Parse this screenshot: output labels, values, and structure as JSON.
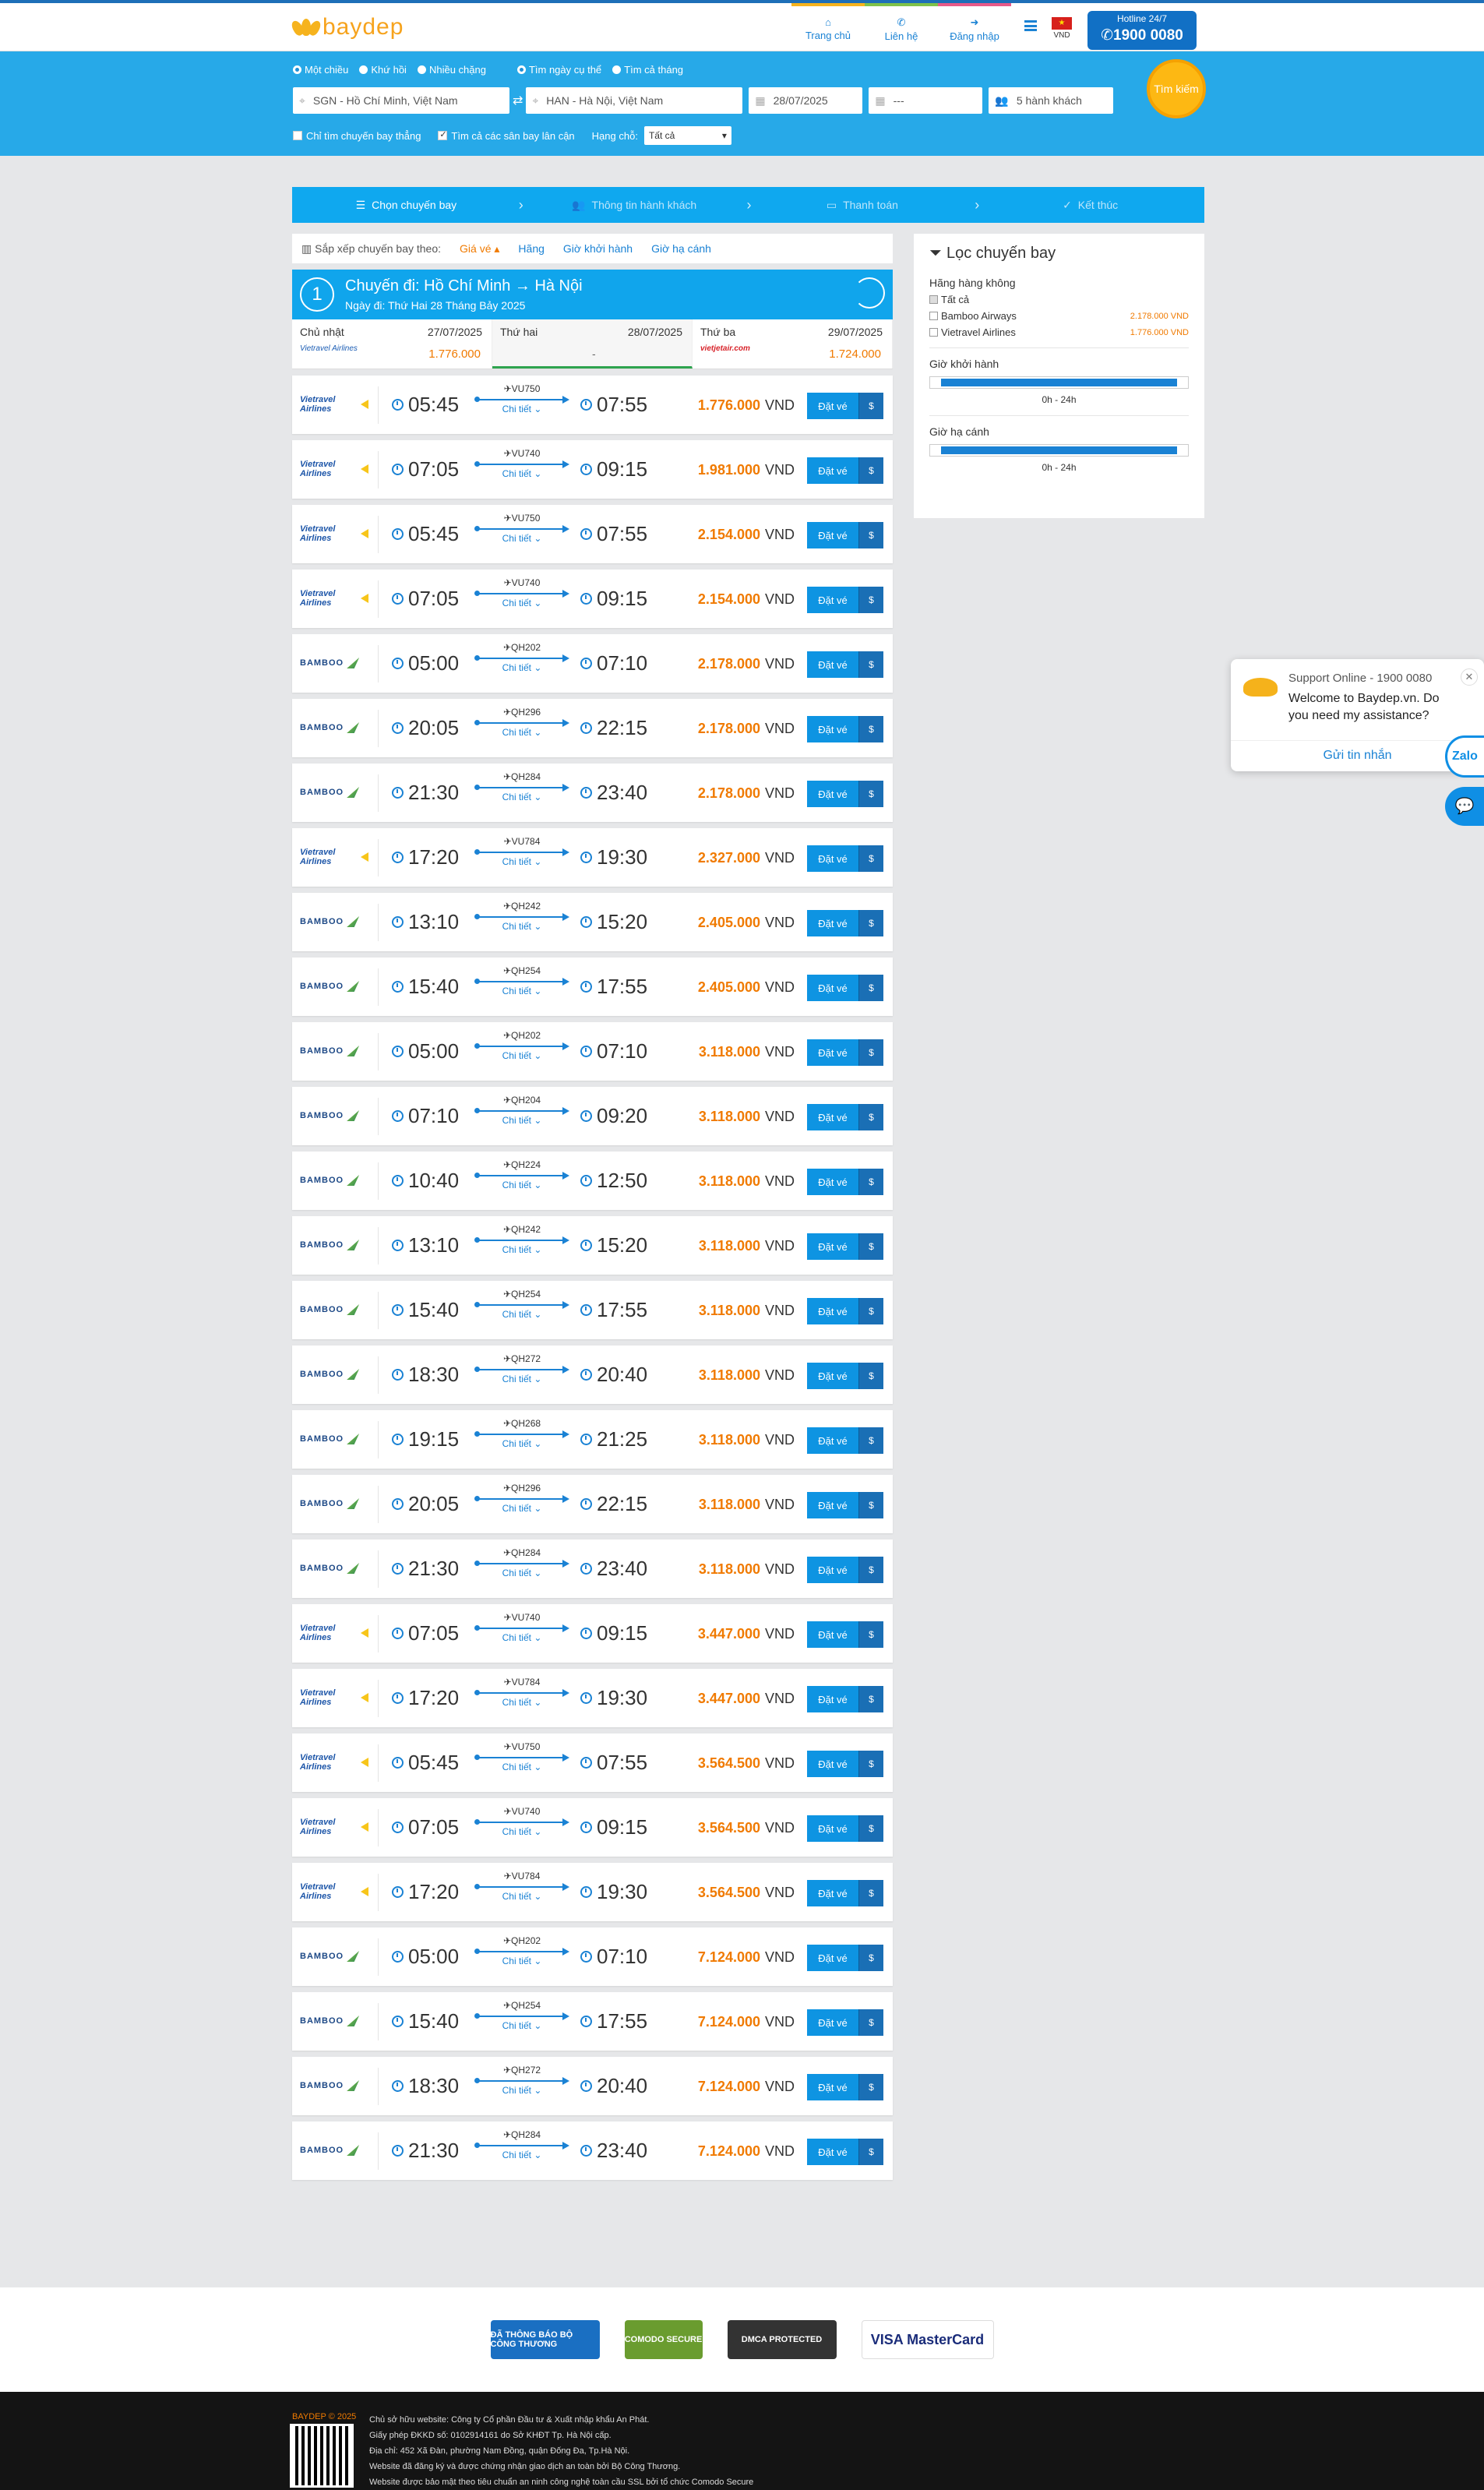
{
  "header": {
    "logo": "baydep",
    "nav": [
      {
        "label": "Trang chủ",
        "icon": "home-icon",
        "color": "#f6b31d"
      },
      {
        "label": "Liên hệ",
        "icon": "phone-icon",
        "color": "#7fc24a"
      },
      {
        "label": "Đăng nhập",
        "icon": "login-icon",
        "color": "#e85a8a"
      }
    ],
    "currency": "VND",
    "hotline_label": "Hotline 24/7",
    "hotline_number": "1900 0080"
  },
  "search": {
    "trip_types": [
      "Một chiều",
      "Khứ hồi",
      "Nhiều chặng"
    ],
    "date_modes": [
      "Tìm ngày cụ thể",
      "Tìm cả tháng"
    ],
    "from": "SGN - Hồ Chí Minh, Việt Nam",
    "to": "HAN - Hà Nội, Việt Nam",
    "depart_date": "28/07/2025",
    "return_date": "---",
    "passengers": "5 hành khách",
    "search_button": "Tìm kiếm",
    "direct_only": "Chỉ tìm chuyến bay thẳng",
    "nearby": "Tìm cả các sân bay lân cận",
    "class_label": "Hạng chỗ:",
    "class_value": "Tất cả"
  },
  "steps": [
    "Chọn chuyến bay",
    "Thông tin hành khách",
    "Thanh toán",
    "Kết thúc"
  ],
  "sort": {
    "label": "Sắp xếp chuyến bay theo:",
    "options": [
      "Giá vé",
      "Hãng",
      "Giờ khởi hành",
      "Giờ hạ cánh"
    ]
  },
  "route": {
    "num": "1",
    "title": "Chuyến đi: Hồ Chí Minh → Hà Nội",
    "date": "Ngày đi: Thứ Hai 28 Tháng Bảy 2025"
  },
  "dates": [
    {
      "day": "Chủ nhật",
      "date": "27/07/2025",
      "airline": "Vietravel Airlines",
      "price": "1.776.000"
    },
    {
      "day": "Thứ hai",
      "date": "28/07/2025",
      "airline": "",
      "price": "-"
    },
    {
      "day": "Thứ ba",
      "date": "29/07/2025",
      "airline": "vietjetair.com",
      "price": "1.724.000"
    }
  ],
  "flights": [
    {
      "airline": "vj",
      "dep": "05:45",
      "no": "VU750",
      "arr": "07:55",
      "price": "1.776.000"
    },
    {
      "airline": "vj",
      "dep": "07:05",
      "no": "VU740",
      "arr": "09:15",
      "price": "1.981.000"
    },
    {
      "airline": "vj",
      "dep": "05:45",
      "no": "VU750",
      "arr": "07:55",
      "price": "2.154.000"
    },
    {
      "airline": "vj",
      "dep": "07:05",
      "no": "VU740",
      "arr": "09:15",
      "price": "2.154.000"
    },
    {
      "airline": "bb",
      "dep": "05:00",
      "no": "QH202",
      "arr": "07:10",
      "price": "2.178.000"
    },
    {
      "airline": "bb",
      "dep": "20:05",
      "no": "QH296",
      "arr": "22:15",
      "price": "2.178.000"
    },
    {
      "airline": "bb",
      "dep": "21:30",
      "no": "QH284",
      "arr": "23:40",
      "price": "2.178.000"
    },
    {
      "airline": "vj",
      "dep": "17:20",
      "no": "VU784",
      "arr": "19:30",
      "price": "2.327.000"
    },
    {
      "airline": "bb",
      "dep": "13:10",
      "no": "QH242",
      "arr": "15:20",
      "price": "2.405.000"
    },
    {
      "airline": "bb",
      "dep": "15:40",
      "no": "QH254",
      "arr": "17:55",
      "price": "2.405.000"
    },
    {
      "airline": "bb",
      "dep": "05:00",
      "no": "QH202",
      "arr": "07:10",
      "price": "3.118.000"
    },
    {
      "airline": "bb",
      "dep": "07:10",
      "no": "QH204",
      "arr": "09:20",
      "price": "3.118.000"
    },
    {
      "airline": "bb",
      "dep": "10:40",
      "no": "QH224",
      "arr": "12:50",
      "price": "3.118.000"
    },
    {
      "airline": "bb",
      "dep": "13:10",
      "no": "QH242",
      "arr": "15:20",
      "price": "3.118.000"
    },
    {
      "airline": "bb",
      "dep": "15:40",
      "no": "QH254",
      "arr": "17:55",
      "price": "3.118.000"
    },
    {
      "airline": "bb",
      "dep": "18:30",
      "no": "QH272",
      "arr": "20:40",
      "price": "3.118.000"
    },
    {
      "airline": "bb",
      "dep": "19:15",
      "no": "QH268",
      "arr": "21:25",
      "price": "3.118.000"
    },
    {
      "airline": "bb",
      "dep": "20:05",
      "no": "QH296",
      "arr": "22:15",
      "price": "3.118.000"
    },
    {
      "airline": "bb",
      "dep": "21:30",
      "no": "QH284",
      "arr": "23:40",
      "price": "3.118.000"
    },
    {
      "airline": "vj",
      "dep": "07:05",
      "no": "VU740",
      "arr": "09:15",
      "price": "3.447.000"
    },
    {
      "airline": "vj",
      "dep": "17:20",
      "no": "VU784",
      "arr": "19:30",
      "price": "3.447.000"
    },
    {
      "airline": "vj",
      "dep": "05:45",
      "no": "VU750",
      "arr": "07:55",
      "price": "3.564.500"
    },
    {
      "airline": "vj",
      "dep": "07:05",
      "no": "VU740",
      "arr": "09:15",
      "price": "3.564.500"
    },
    {
      "airline": "vj",
      "dep": "17:20",
      "no": "VU784",
      "arr": "19:30",
      "price": "3.564.500"
    },
    {
      "airline": "bb",
      "dep": "05:00",
      "no": "QH202",
      "arr": "07:10",
      "price": "7.124.000"
    },
    {
      "airline": "bb",
      "dep": "15:40",
      "no": "QH254",
      "arr": "17:55",
      "price": "7.124.000"
    },
    {
      "airline": "bb",
      "dep": "18:30",
      "no": "QH272",
      "arr": "20:40",
      "price": "7.124.000"
    },
    {
      "airline": "bb",
      "dep": "21:30",
      "no": "QH284",
      "arr": "23:40",
      "price": "7.124.000"
    }
  ],
  "flight_labels": {
    "detail": "Chi tiết",
    "currency": "VND",
    "book": "Đặt vé",
    "dollar": "$",
    "vj_name": "Vietravel Airlines",
    "bb_name": "BAMBOO"
  },
  "filter": {
    "title": "Lọc chuyến bay",
    "airline_head": "Hãng hàng không",
    "all": "Tất cả",
    "airlines": [
      {
        "name": "Bamboo Airways",
        "price": "2.178.000 VND"
      },
      {
        "name": "Vietravel Airlines",
        "price": "1.776.000 VND"
      }
    ],
    "dep_head": "Giờ khởi hành",
    "dep_range": "0h - 24h",
    "arr_head": "Giờ hạ cánh",
    "arr_range": "0h - 24h"
  },
  "support": {
    "title": "Support Online - 1900 0080",
    "message": "Welcome to Baydep.vn. Do you need my assistance?",
    "button": "Gửi tin nhắn",
    "zalo": "Zalo"
  },
  "badges": [
    "ĐÃ THÔNG BÁO BỘ CÔNG THƯƠNG",
    "COMODO SECURE",
    "DMCA PROTECTED",
    "VISA MasterCard"
  ],
  "footer": {
    "copyright": "BAYDEP © 2025",
    "lines": [
      "Chủ sở hữu website: Công ty Cổ phần Đầu tư & Xuất nhập khẩu An Phát.",
      "Giấy phép ĐKKD số: 0102914161 do Sở KHĐT Tp. Hà Nội cấp.",
      "Địa chỉ: 452 Xã Đàn, phường Nam Đồng, quận Đống Đa, Tp.Hà Nội.",
      "Website đã đăng ký và được chứng nhận giao dịch an toàn bởi Bộ Công Thương.",
      "Website được bảo mật theo tiêu chuẩn an ninh công nghệ toàn cầu SSL bởi tổ chức Comodo Secure"
    ]
  },
  "colors": {
    "accent": "#27a9e8",
    "price": "#f07a00",
    "brand": "#f6a31d"
  }
}
